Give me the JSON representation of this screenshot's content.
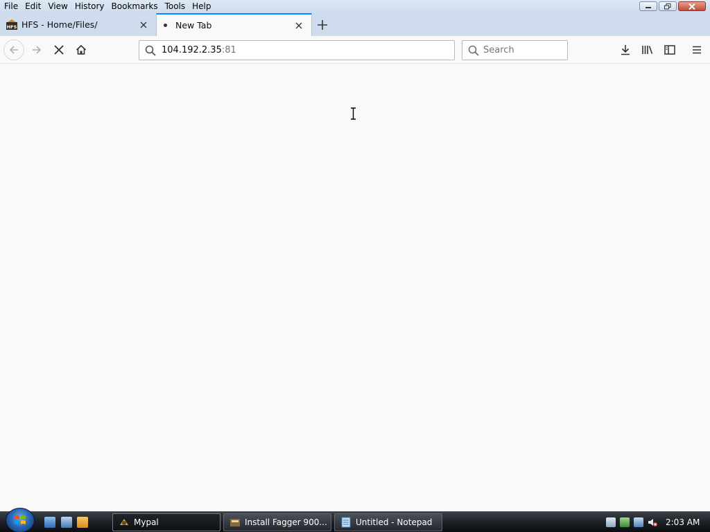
{
  "menubar": {
    "items": [
      "File",
      "Edit",
      "View",
      "History",
      "Bookmarks",
      "Tools",
      "Help"
    ]
  },
  "tabs": [
    {
      "label": "HFS - Home/Files/",
      "icon": "hfs-favicon-icon",
      "active": false
    },
    {
      "label": "New Tab",
      "icon": "loading-dot-icon",
      "active": true
    }
  ],
  "navbar": {
    "url_host": "104.192.2.35",
    "url_port": ":81",
    "search_placeholder": "Search"
  },
  "taskbar": {
    "items": [
      {
        "label": "Mypal",
        "icon": "mypal-icon",
        "active": true
      },
      {
        "label": "Install Fagger 900...",
        "icon": "installer-icon",
        "active": false
      },
      {
        "label": "Untitled - Notepad",
        "icon": "notepad-icon",
        "active": false
      }
    ],
    "clock": "2:03 AM"
  },
  "colors": {
    "accent": "#0a84ff",
    "tabstrip": "#cfdcee",
    "page_bg": "#f9f9fa"
  }
}
